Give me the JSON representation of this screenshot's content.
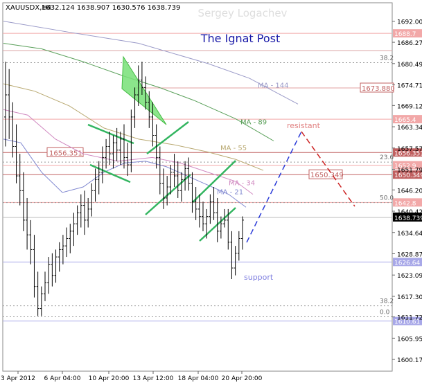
{
  "chart_data": {
    "type": "candlestick",
    "symbol_label": "XAUUSDX,H4",
    "ohlc_label": "1632.124 1638.907 1630.576 1638.739",
    "watermark": "Sergey Logachev",
    "title": "The Ignat Post",
    "ylim": [
      1597,
      1697
    ],
    "current_price": "1638.739",
    "y_ticks": [
      "1692.00",
      "1686.27",
      "1680.49",
      "1674.71",
      "1669.12",
      "1663.34",
      "1657.57",
      "1651.79",
      "1646.20",
      "1640.42",
      "1634.64",
      "1628.87",
      "1623.09",
      "1617.30",
      "1611.72",
      "1605.95",
      "1600.17"
    ],
    "x_ticks": [
      "3 Apr 2012",
      "6 Apr 04:00",
      "10 Apr 20:00",
      "13 Apr 12:00",
      "18 Apr 04:00",
      "20 Apr 20:00"
    ],
    "moving_averages": [
      {
        "name": "MA - 144",
        "color": "#9a9ac8",
        "label_x": 372,
        "label_price": 1674.0,
        "points": [
          [
            5,
            1692
          ],
          [
            100,
            1689
          ],
          [
            200,
            1686
          ],
          [
            300,
            1680.5
          ],
          [
            360,
            1676.5
          ],
          [
            430,
            1669.5
          ]
        ]
      },
      {
        "name": "MA - 89",
        "color": "#5aa05a",
        "label_x": 347,
        "label_price": 1664.0,
        "points": [
          [
            5,
            1686
          ],
          [
            60,
            1684.5
          ],
          [
            120,
            1681
          ],
          [
            180,
            1677
          ],
          [
            230,
            1674
          ],
          [
            280,
            1670.5
          ],
          [
            340,
            1665.5
          ],
          [
            395,
            1659.5
          ]
        ]
      },
      {
        "name": "MA - 55",
        "color": "#b8a870",
        "label_x": 318,
        "label_price": 1657.0,
        "points": [
          [
            5,
            1675
          ],
          [
            50,
            1673
          ],
          [
            100,
            1669
          ],
          [
            150,
            1663
          ],
          [
            200,
            1660
          ],
          [
            250,
            1658.5
          ],
          [
            300,
            1656.5
          ],
          [
            340,
            1654.5
          ],
          [
            380,
            1651.5
          ]
        ]
      },
      {
        "name": "MA - 34",
        "color": "#d088c0",
        "label_x": 330,
        "label_price": 1647.5,
        "points": [
          [
            5,
            1668
          ],
          [
            40,
            1666.5
          ],
          [
            80,
            1660
          ],
          [
            120,
            1656
          ],
          [
            170,
            1654
          ],
          [
            220,
            1655
          ],
          [
            260,
            1653.5
          ],
          [
            300,
            1651
          ],
          [
            340,
            1648.5
          ],
          [
            365,
            1645
          ]
        ]
      },
      {
        "name": "MA - 21",
        "color": "#8088d0",
        "label_x": 313,
        "label_price": 1645.0,
        "points": [
          [
            5,
            1660
          ],
          [
            30,
            1659
          ],
          [
            60,
            1651
          ],
          [
            90,
            1645.5
          ],
          [
            120,
            1647
          ],
          [
            150,
            1651
          ],
          [
            180,
            1653.5
          ],
          [
            210,
            1654
          ],
          [
            240,
            1652.5
          ],
          [
            270,
            1650
          ],
          [
            300,
            1647.5
          ],
          [
            330,
            1645
          ],
          [
            355,
            1641.5
          ]
        ]
      }
    ],
    "horizontal_levels": [
      {
        "price": 1688.7,
        "color": "#f2a8a8",
        "label": "1688.7"
      },
      {
        "price": 1684.0,
        "color": "#d9a0a0",
        "label": ""
      },
      {
        "price": 1665.4,
        "color": "#f2a8a8",
        "label": "1665.4"
      },
      {
        "price": 1656.351,
        "color": "#c06060",
        "label": "1656.351"
      },
      {
        "price": 1652.9,
        "color": "#f2a8a8",
        "label": "1652.9"
      },
      {
        "price": 1650.349,
        "color": "#c06060",
        "label": "1650.349"
      },
      {
        "price": 1642.8,
        "color": "#f2a8a8",
        "label": "1642.8"
      },
      {
        "price": 1626.64,
        "color": "#a8a8e8",
        "label": "1626.64"
      },
      {
        "price": 1610.61,
        "color": "#a8a8e8",
        "label": "1610.61"
      }
    ],
    "level_values": [
      "1673.880"
    ],
    "fib_labels": [
      {
        "text": "38.2",
        "price": 1681.5
      },
      {
        "text": "23.6",
        "price": 1654.5
      },
      {
        "text": "50.0",
        "price": 1643.5
      },
      {
        "text": "38.2",
        "price": 1615.5
      },
      {
        "text": "0.0",
        "price": 1612.5
      }
    ],
    "annotations": [
      {
        "text": "resistant",
        "color": "#e08080"
      },
      {
        "text": "support",
        "color": "#8080e0"
      }
    ],
    "candles": [
      [
        1666,
        1681,
        1658,
        1672
      ],
      [
        1672,
        1679,
        1660,
        1666
      ],
      [
        1666,
        1670,
        1655,
        1658
      ],
      [
        1658,
        1664,
        1648,
        1650
      ],
      [
        1650,
        1656,
        1642,
        1646
      ],
      [
        1646,
        1651,
        1635,
        1638
      ],
      [
        1638,
        1644,
        1630,
        1634
      ],
      [
        1634,
        1638,
        1626,
        1630
      ],
      [
        1630,
        1634,
        1617,
        1620
      ],
      [
        1620,
        1624,
        1612,
        1614
      ],
      [
        1614,
        1620,
        1612,
        1618
      ],
      [
        1618,
        1624,
        1616,
        1621
      ],
      [
        1621,
        1628,
        1618,
        1626
      ],
      [
        1626,
        1629,
        1620,
        1623
      ],
      [
        1623,
        1630,
        1621,
        1628
      ],
      [
        1628,
        1632,
        1624,
        1630
      ],
      [
        1630,
        1634,
        1626,
        1631
      ],
      [
        1631,
        1636,
        1628,
        1633
      ],
      [
        1633,
        1637,
        1629,
        1635
      ],
      [
        1635,
        1640,
        1631,
        1637
      ],
      [
        1637,
        1642,
        1634,
        1640
      ],
      [
        1640,
        1645,
        1636,
        1642
      ],
      [
        1642,
        1646,
        1634,
        1638
      ],
      [
        1638,
        1644,
        1636,
        1641
      ],
      [
        1641,
        1648,
        1639,
        1646
      ],
      [
        1646,
        1652,
        1643,
        1649
      ],
      [
        1649,
        1654,
        1645,
        1651
      ],
      [
        1651,
        1658,
        1648,
        1655
      ],
      [
        1655,
        1660,
        1652,
        1658
      ],
      [
        1658,
        1662,
        1653,
        1656
      ],
      [
        1656,
        1661,
        1652,
        1659
      ],
      [
        1659,
        1663,
        1654,
        1657
      ],
      [
        1657,
        1662,
        1653,
        1660
      ],
      [
        1660,
        1664,
        1652,
        1655
      ],
      [
        1655,
        1659,
        1650,
        1653
      ],
      [
        1653,
        1668,
        1651,
        1666
      ],
      [
        1666,
        1674,
        1663,
        1672
      ],
      [
        1672,
        1680,
        1669,
        1676
      ],
      [
        1676,
        1681,
        1672,
        1674
      ],
      [
        1674,
        1677,
        1668,
        1670
      ],
      [
        1670,
        1673,
        1663,
        1666
      ],
      [
        1666,
        1670,
        1658,
        1661
      ],
      [
        1661,
        1664,
        1652,
        1655
      ],
      [
        1655,
        1658,
        1645,
        1648
      ],
      [
        1648,
        1652,
        1641,
        1644
      ],
      [
        1644,
        1650,
        1642,
        1647
      ],
      [
        1647,
        1653,
        1645,
        1651
      ],
      [
        1651,
        1656,
        1647,
        1650
      ],
      [
        1650,
        1654,
        1644,
        1646
      ],
      [
        1646,
        1651,
        1643,
        1649
      ],
      [
        1649,
        1654,
        1646,
        1652
      ],
      [
        1652,
        1655,
        1646,
        1648
      ],
      [
        1648,
        1651,
        1640,
        1643
      ],
      [
        1643,
        1647,
        1638,
        1641
      ],
      [
        1641,
        1645,
        1636,
        1639
      ],
      [
        1639,
        1643,
        1635,
        1637
      ],
      [
        1637,
        1641,
        1633,
        1639
      ],
      [
        1639,
        1645,
        1637,
        1643
      ],
      [
        1643,
        1647,
        1638,
        1640
      ],
      [
        1640,
        1644,
        1632,
        1635
      ],
      [
        1635,
        1639,
        1633,
        1637
      ],
      [
        1637,
        1641,
        1636,
        1638
      ],
      [
        1638,
        1641,
        1630,
        1632
      ],
      [
        1632,
        1635,
        1622,
        1625
      ],
      [
        1625,
        1631,
        1623,
        1629
      ],
      [
        1629,
        1635,
        1627,
        1633
      ],
      [
        1633,
        1639,
        1630,
        1638
      ]
    ]
  }
}
